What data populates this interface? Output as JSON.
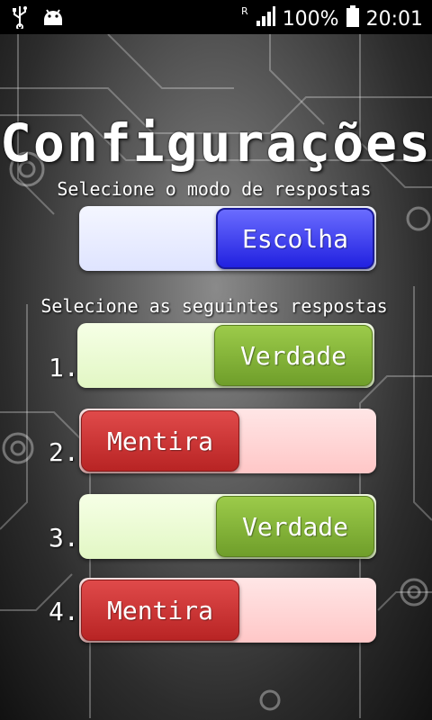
{
  "status_bar": {
    "left_icons": [
      "usb-icon",
      "android-icon"
    ],
    "roaming_indicator": "R",
    "battery": "100%",
    "time": "20:01"
  },
  "title": "Configurações",
  "mode_prompt": "Selecione o modo de respostas",
  "mode_toggle": {
    "label": "Escolha"
  },
  "answers_prompt": "Selecione as seguintes respostas",
  "answers": [
    {
      "number": "1.",
      "label": "Verdade",
      "state": "on"
    },
    {
      "number": "2.",
      "label": "Mentira",
      "state": "off"
    },
    {
      "number": "3.",
      "label": "Verdade",
      "state": "on"
    },
    {
      "number": "4.",
      "label": "Mentira",
      "state": "off"
    }
  ],
  "colors": {
    "mode_knob": "#2a2ae8",
    "true_knob": "#86b43a",
    "false_knob": "#cc3333"
  }
}
